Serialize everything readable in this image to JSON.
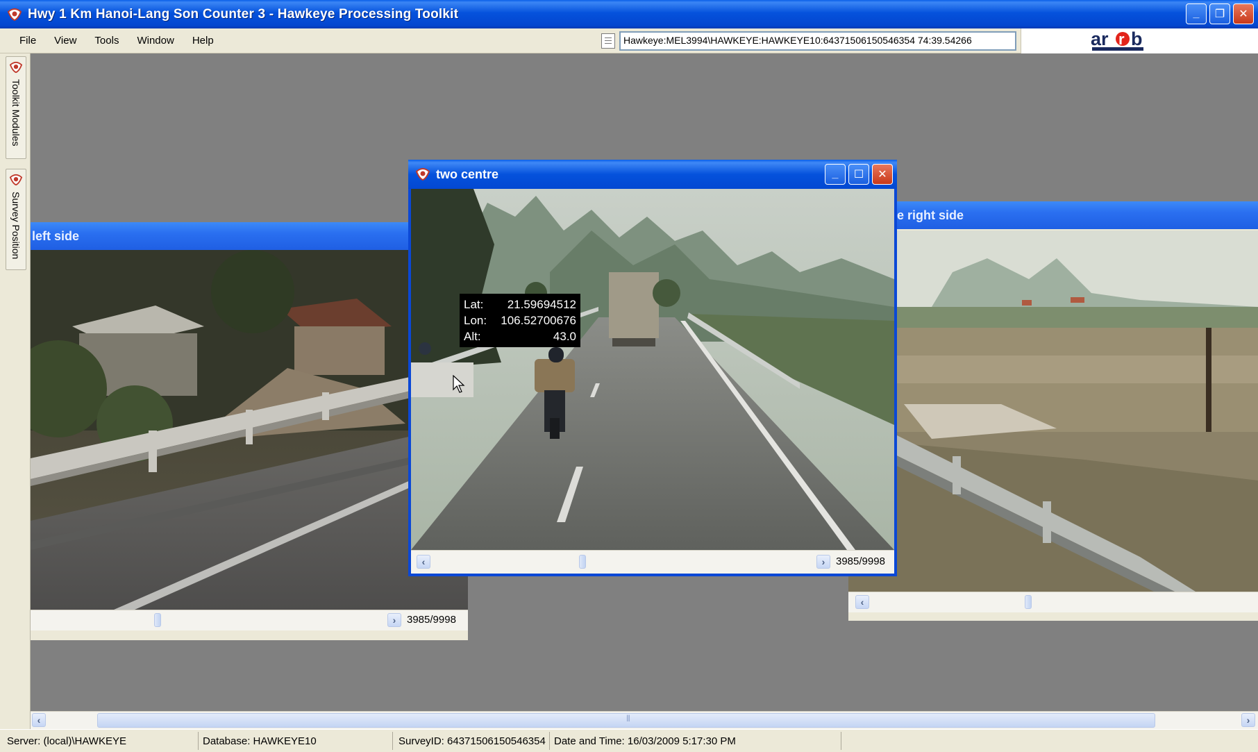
{
  "window": {
    "title": "Hwy 1 Km Hanoi-Lang Son Counter 3 - Hawkeye Processing Toolkit",
    "minimize": "_",
    "restore": "❐",
    "close": "✕"
  },
  "menu": {
    "items": [
      "File",
      "View",
      "Tools",
      "Window",
      "Help"
    ]
  },
  "toolbar": {
    "path_value": "Hawkeye:MEL3994\\HAWKEYE:HAWKEYE10:64371506150546354 74:39.54266",
    "logo_text": "arrb"
  },
  "dock": {
    "tabs": [
      {
        "label": "Toolkit Modules",
        "icon": "hawkeye-icon"
      },
      {
        "label": "Survey Position",
        "icon": "hawkeye-icon"
      }
    ]
  },
  "windows": {
    "left": {
      "title": "left side",
      "frame": "3985/9998"
    },
    "centre": {
      "title": "two centre",
      "frame": "3985/9998"
    },
    "right": {
      "title": "e right side"
    }
  },
  "gps_tooltip": {
    "lat_label": "Lat:",
    "lat_value": "21.59694512",
    "lon_label": "Lon:",
    "lon_value": "106.52700676",
    "alt_label": "Alt:",
    "alt_value": "43.0"
  },
  "statusbar": {
    "server": "Server: (local)\\HAWKEYE",
    "database": "Database: HAWKEYE10",
    "survey": "SurveyID: 64371506150546354",
    "datetime": "Date and Time: 16/03/2009 5:17:30 PM"
  },
  "colors": {
    "title_blue": "#0552dc",
    "mdi_gray": "#808080",
    "xp_face": "#ece9d8"
  }
}
